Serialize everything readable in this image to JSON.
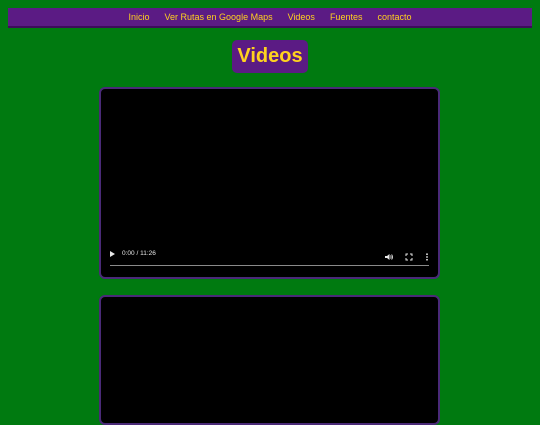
{
  "nav": {
    "items": [
      {
        "label": "Inicio"
      },
      {
        "label": "Ver Rutas en Google Maps"
      },
      {
        "label": "Videos"
      },
      {
        "label": "Fuentes"
      },
      {
        "label": "contacto"
      }
    ]
  },
  "page": {
    "title": "Videos"
  },
  "videos": [
    {
      "time": "0:00 / 11:26"
    },
    {
      "time": ""
    }
  ],
  "colors": {
    "background": "#007a10",
    "nav_bg": "#5b1b84",
    "accent_text": "#ffd21f",
    "video_border": "#4a2a78"
  },
  "icons": {
    "play": "play-icon",
    "volume": "volume-icon",
    "fullscreen": "fullscreen-icon",
    "more": "more-options-icon"
  }
}
